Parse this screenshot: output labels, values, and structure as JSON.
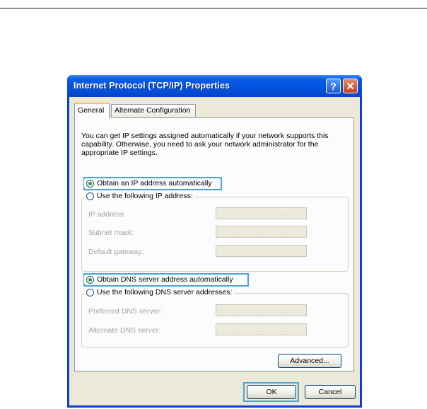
{
  "window": {
    "title": "Internet Protocol (TCP/IP) Properties",
    "help_glyph": "?",
    "close_glyph": "✕"
  },
  "tabs": [
    {
      "label": "General",
      "selected": true
    },
    {
      "label": "Alternate Configuration",
      "selected": false
    }
  ],
  "intro": "You can get IP settings assigned automatically if your network supports this capability. Otherwise, you need to ask your network administrator for the appropriate IP settings.",
  "ip": {
    "auto_label": "Obtain an IP address automatically",
    "manual_label": "Use the following IP address:",
    "fields": [
      {
        "label": "IP address:"
      },
      {
        "label": "Subnet mask:"
      },
      {
        "label": "Default gateway:"
      }
    ]
  },
  "dns": {
    "auto_label": "Obtain DNS server address automatically",
    "manual_label": "Use the following DNS server addresses:",
    "fields": [
      {
        "label": "Preferred DNS server:"
      },
      {
        "label": "Alternate DNS server:"
      }
    ]
  },
  "buttons": {
    "advanced": "Advanced...",
    "ok": "OK",
    "cancel": "Cancel"
  },
  "colors": {
    "titlebar": "#0454e0",
    "dialog_bg": "#ece9d8",
    "highlight": "#4aa4d8",
    "radio_dot": "#21a121"
  }
}
